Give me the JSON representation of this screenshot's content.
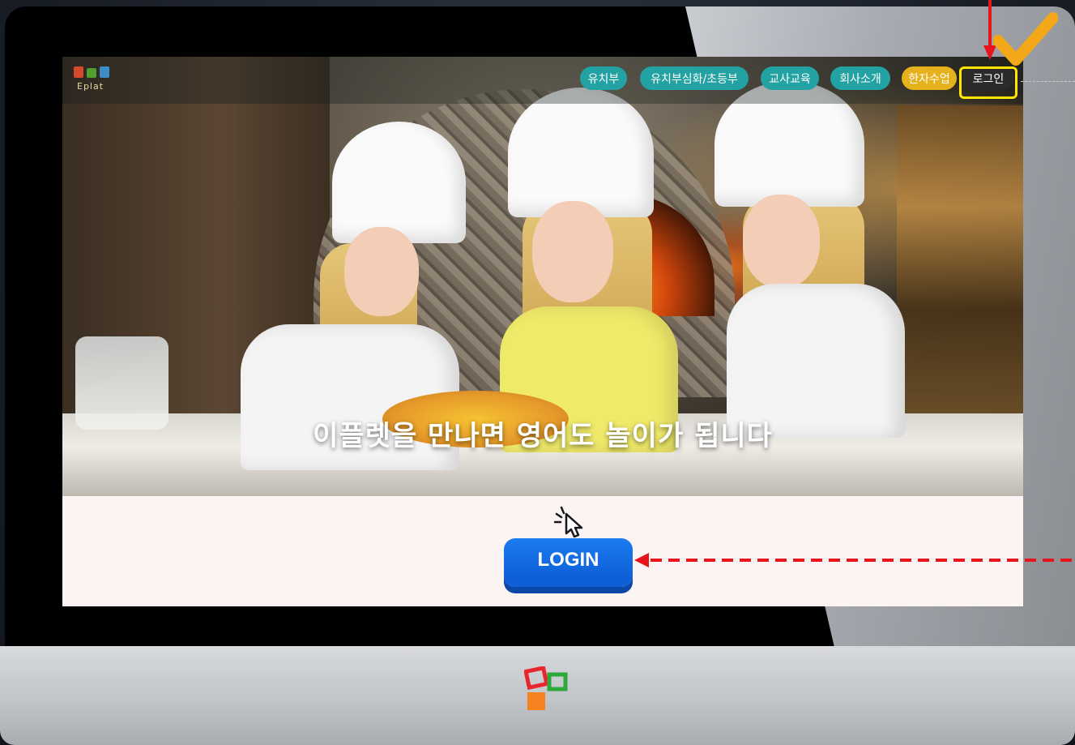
{
  "navbar": {
    "brand_text": "Eplat",
    "items": [
      {
        "label": "유치부"
      },
      {
        "label": "유치부심화/초등부"
      },
      {
        "label": "교사교육"
      },
      {
        "label": "회사소개"
      },
      {
        "label": "한자수업"
      },
      {
        "label": "로그인"
      }
    ]
  },
  "hero": {
    "caption": "이플렛을 만나면 영어도 놀이가 됩니다"
  },
  "login": {
    "button_label": "LOGIN"
  },
  "colors": {
    "nav_teal": "#23a2a3",
    "nav_gold": "#e5b21d",
    "login_blue": "#1a7bf0",
    "highlight_yellow": "#ffe600",
    "annotation_red": "#e8141c",
    "checkmark_orange": "#f2a818"
  }
}
